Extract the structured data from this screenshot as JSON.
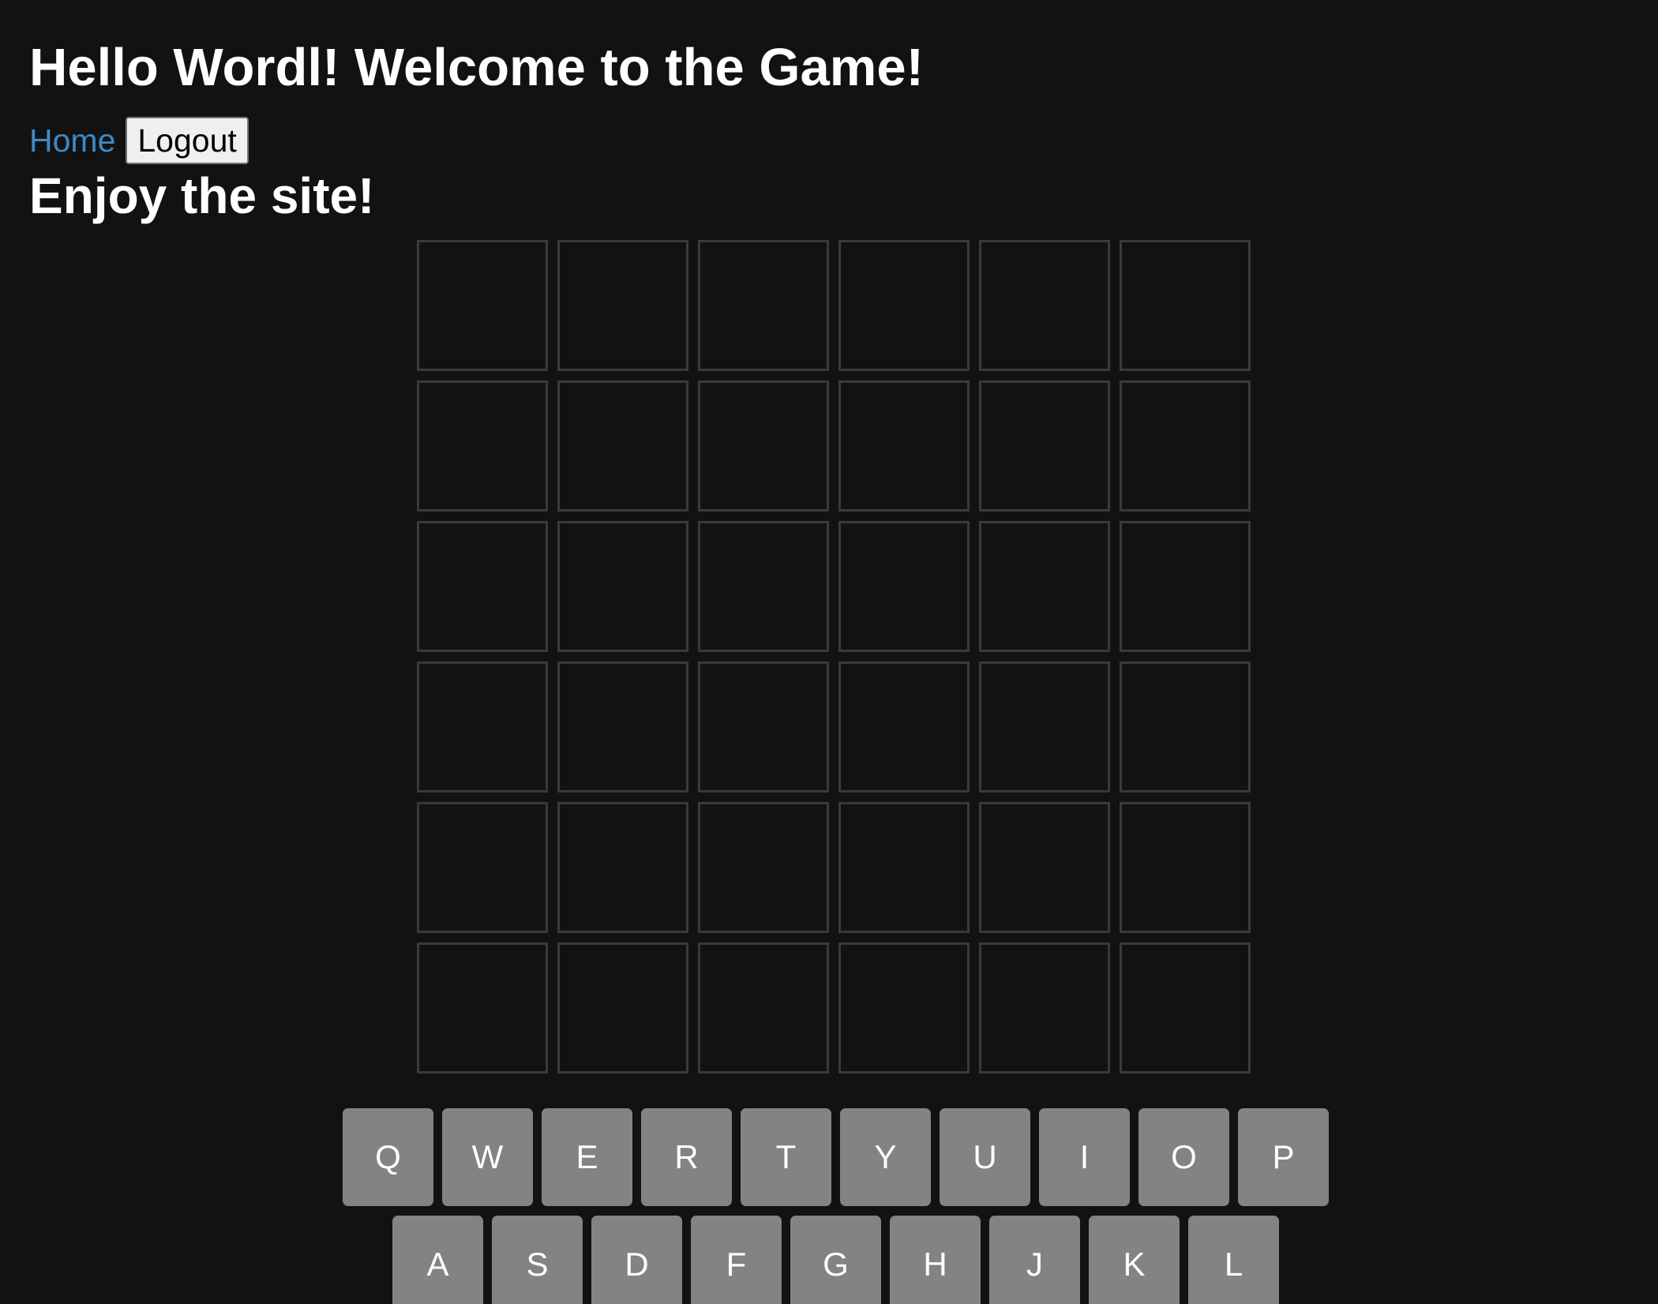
{
  "header": {
    "title": "Hello Wordl! Welcome to the Game!",
    "home_link": "Home",
    "logout_button": "Logout",
    "subtitle": "Enjoy the site!"
  },
  "board": {
    "rows": [
      [
        "",
        "",
        "",
        "",
        "",
        ""
      ],
      [
        "",
        "",
        "",
        "",
        "",
        ""
      ],
      [
        "",
        "",
        "",
        "",
        "",
        ""
      ],
      [
        "",
        "",
        "",
        "",
        "",
        ""
      ],
      [
        "",
        "",
        "",
        "",
        "",
        ""
      ],
      [
        "",
        "",
        "",
        "",
        "",
        ""
      ]
    ]
  },
  "keyboard": {
    "rows": [
      [
        "Q",
        "W",
        "E",
        "R",
        "T",
        "Y",
        "U",
        "I",
        "O",
        "P"
      ],
      [
        "A",
        "S",
        "D",
        "F",
        "G",
        "H",
        "J",
        "K",
        "L"
      ]
    ]
  },
  "colors": {
    "background": "#121212",
    "tile_border": "#3a3a3c",
    "key_background": "#818384",
    "link": "#3f89c6"
  }
}
